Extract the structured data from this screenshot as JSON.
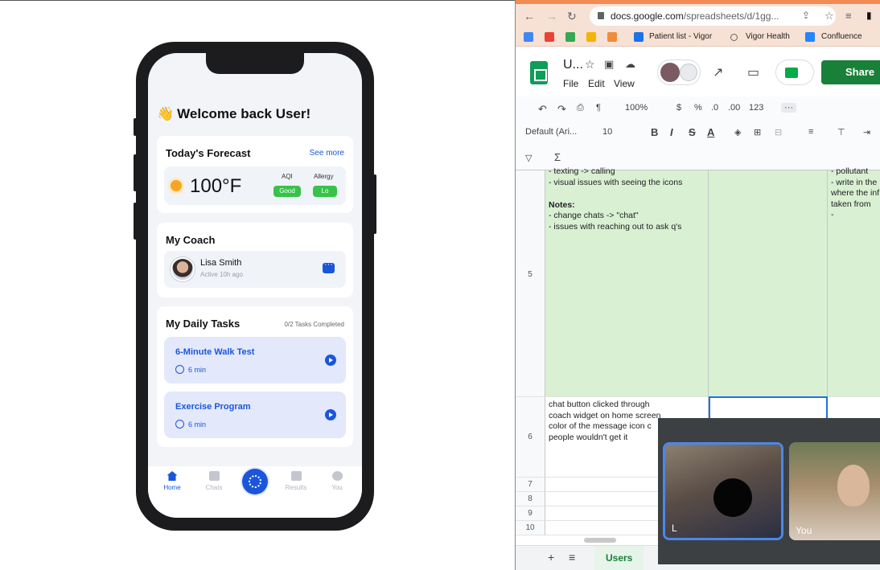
{
  "phone": {
    "welcome": "Welcome back User!",
    "wave_emoji": "👋",
    "forecast": {
      "title": "Today's Forecast",
      "see_more": "See more",
      "temperature": "100°F",
      "aqi_label": "AQI",
      "aqi_value": "Good",
      "allergy_label": "Allergy",
      "allergy_value": "Lo"
    },
    "coach": {
      "title": "My Coach",
      "name": "Lisa Smith",
      "status": "Active 10h ago"
    },
    "tasks": {
      "title": "My Daily Tasks",
      "count": "0/2 Tasks Completed",
      "items": [
        {
          "name": "6-Minute Walk Test",
          "time": "6 min"
        },
        {
          "name": "Exercise Program",
          "time": "6 min"
        }
      ]
    },
    "tabbar": {
      "home": "Home",
      "chats": "Chats",
      "results": "Results",
      "you": "You"
    }
  },
  "browser": {
    "url_host": "docs.google.com",
    "url_path": "/spreadsheets/d/1gg...",
    "bookmarks": [
      "Patient list - Vigor",
      "Vigor Health",
      "Confluence"
    ],
    "doc_title": "U...",
    "menu": [
      "File",
      "Edit",
      "View"
    ],
    "share_label": "Share",
    "toolbar": {
      "zoom": "100%",
      "currency": "$",
      "percent": "%",
      "dec_less": ".0",
      "dec_more": ".00",
      "number_format": "123",
      "font": "Default (Ari...",
      "font_size": "10",
      "bold": "B",
      "italic": "I",
      "strike": "S",
      "text_color": "A"
    },
    "rows": {
      "r5": "5",
      "r6": "6",
      "r7": "7",
      "r8": "8",
      "r9": "9",
      "r10": "10"
    },
    "cells": {
      "a5_top": "- texting -> calling\n- visual issues with seeing the icons",
      "a5_notes_head": "Notes:",
      "a5_notes": "- change chats -> \"chat\"\n- issues with reaching out to ask q's",
      "c5": "- pollutant\n- write in the\nwhere the inf\ntaken from\n-",
      "a6": "chat button clicked through\ncoach widget on home screen\ncolor of the message icon c\npeople wouldn't get it"
    },
    "sheet_tab": "Users",
    "meet": {
      "tile1_label": "L",
      "tile2_label": "You"
    }
  },
  "colors": {
    "brand_blue": "#1a56db",
    "good_green": "#37c34a",
    "sheets_green": "#188038",
    "cell_green": "#d9f0d3"
  }
}
